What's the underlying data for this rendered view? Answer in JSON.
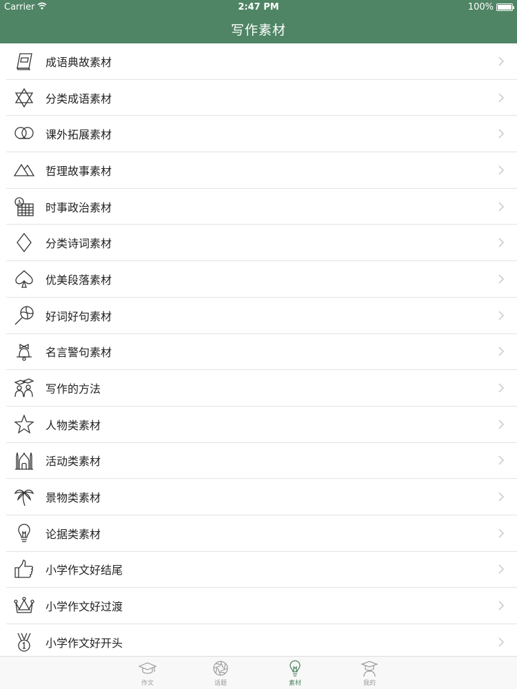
{
  "status_bar": {
    "carrier": "Carrier",
    "time": "2:47 PM",
    "battery": "100%"
  },
  "nav": {
    "title": "写作素材"
  },
  "list": {
    "items": [
      {
        "label": "成语典故素材",
        "icon": "book-icon"
      },
      {
        "label": "分类成语素材",
        "icon": "star-of-david-icon"
      },
      {
        "label": "课外拓展素材",
        "icon": "pretzel-icon"
      },
      {
        "label": "哲理故事素材",
        "icon": "mountains-icon"
      },
      {
        "label": "时事政治素材",
        "icon": "calendar-clock-icon"
      },
      {
        "label": "分类诗词素材",
        "icon": "diamond-icon"
      },
      {
        "label": "优美段落素材",
        "icon": "spade-icon"
      },
      {
        "label": "好词好句素材",
        "icon": "lollipop-icon"
      },
      {
        "label": "名言警句素材",
        "icon": "bell-icon"
      },
      {
        "label": "写作的方法",
        "icon": "graduates-icon"
      },
      {
        "label": "人物类素材",
        "icon": "star-icon"
      },
      {
        "label": "活动类素材",
        "icon": "mosque-icon"
      },
      {
        "label": "景物类素材",
        "icon": "palm-tree-icon"
      },
      {
        "label": "论据类素材",
        "icon": "lightbulb-icon"
      },
      {
        "label": "小学作文好结尾",
        "icon": "thumbs-up-icon"
      },
      {
        "label": "小学作文好过渡",
        "icon": "crown-icon"
      },
      {
        "label": "小学作文好开头",
        "icon": "medal-icon"
      }
    ]
  },
  "tabbar": {
    "tabs": [
      {
        "label": "作文",
        "icon": "mortarboard-icon"
      },
      {
        "label": "话题",
        "icon": "aperture-icon"
      },
      {
        "label": "素材",
        "icon": "lightbulb-icon"
      },
      {
        "label": "我的",
        "icon": "graduate-icon"
      }
    ]
  },
  "colors": {
    "accent": "#4f8565",
    "tab_inactive": "#999999"
  }
}
